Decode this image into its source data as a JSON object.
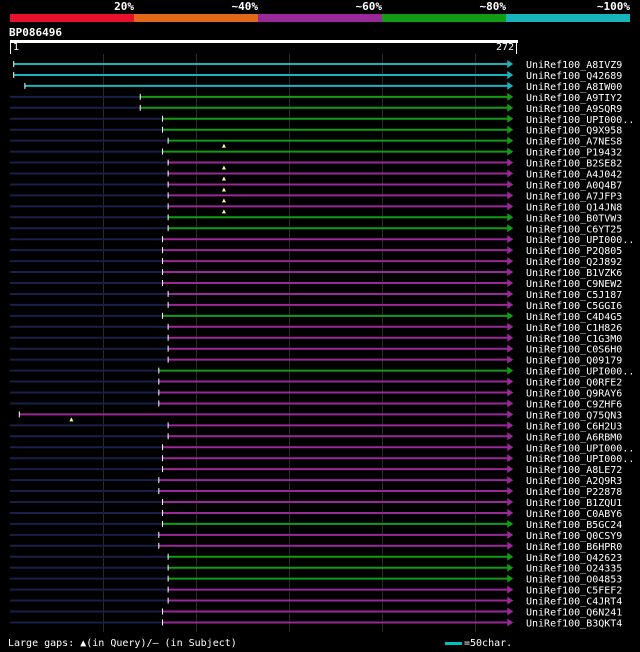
{
  "legend": {
    "labels": [
      "20%",
      "~40%",
      "~60%",
      "~80%",
      "~100%"
    ],
    "colors": [
      "#e8102c",
      "#e06818",
      "#9a2898",
      "#139c13",
      "#18b4bc"
    ]
  },
  "query": {
    "id": "BP086496",
    "start": "1",
    "end": "272"
  },
  "hits": [
    {
      "label": "UniRef100_A8IVZ9",
      "color": "#18b4bc",
      "segments": [
        [
          2,
          270
        ]
      ],
      "dark": [],
      "marks": []
    },
    {
      "label": "UniRef100_Q42689",
      "color": "#18b4bc",
      "segments": [
        [
          2,
          270
        ]
      ],
      "dark": [],
      "marks": []
    },
    {
      "label": "UniRef100_A8IW00",
      "color": "#18b4bc",
      "segments": [
        [
          8,
          270
        ]
      ],
      "dark": [],
      "marks": []
    },
    {
      "label": "UniRef100_A9TIY2",
      "color": "#139c13",
      "segments": [
        [
          70,
          270
        ]
      ],
      "dark": [
        [
          0,
          70
        ]
      ],
      "marks": []
    },
    {
      "label": "UniRef100_A9SQR9",
      "color": "#139c13",
      "segments": [
        [
          70,
          270
        ]
      ],
      "dark": [
        [
          0,
          70
        ]
      ],
      "marks": []
    },
    {
      "label": "UniRef100_UPI000..",
      "color": "#139c13",
      "segments": [
        [
          82,
          270
        ]
      ],
      "dark": [
        [
          0,
          82
        ]
      ],
      "marks": []
    },
    {
      "label": "UniRef100_Q9X958",
      "color": "#139c13",
      "segments": [
        [
          82,
          270
        ]
      ],
      "dark": [
        [
          0,
          82
        ]
      ],
      "marks": []
    },
    {
      "label": "UniRef100_A7NES8",
      "color": "#139c13",
      "segments": [
        [
          85,
          270
        ]
      ],
      "dark": [
        [
          0,
          85
        ]
      ],
      "marks": [
        115
      ]
    },
    {
      "label": "UniRef100_P19432",
      "color": "#139c13",
      "segments": [
        [
          82,
          270
        ]
      ],
      "dark": [
        [
          0,
          82
        ]
      ],
      "marks": []
    },
    {
      "label": "UniRef100_B2SE82",
      "color": "#9a2898",
      "segments": [
        [
          85,
          270
        ]
      ],
      "dark": [
        [
          0,
          85
        ]
      ],
      "marks": [
        115
      ]
    },
    {
      "label": "UniRef100_A4J042",
      "color": "#9a2898",
      "segments": [
        [
          85,
          270
        ]
      ],
      "dark": [
        [
          0,
          85
        ]
      ],
      "marks": [
        115
      ]
    },
    {
      "label": "UniRef100_A0Q4B7",
      "color": "#9a2898",
      "segments": [
        [
          85,
          270
        ]
      ],
      "dark": [
        [
          0,
          85
        ]
      ],
      "marks": [
        115
      ]
    },
    {
      "label": "UniRef100_A7JFP3",
      "color": "#9a2898",
      "segments": [
        [
          85,
          270
        ]
      ],
      "dark": [
        [
          0,
          85
        ]
      ],
      "marks": [
        115
      ]
    },
    {
      "label": "UniRef100_Q14JN8",
      "color": "#9a2898",
      "segments": [
        [
          85,
          270
        ]
      ],
      "dark": [
        [
          0,
          85
        ]
      ],
      "marks": [
        115
      ]
    },
    {
      "label": "UniRef100_B0TVW3",
      "color": "#139c13",
      "segments": [
        [
          85,
          270
        ]
      ],
      "dark": [
        [
          0,
          85
        ]
      ],
      "marks": []
    },
    {
      "label": "UniRef100_C6YT25",
      "color": "#139c13",
      "segments": [
        [
          85,
          270
        ]
      ],
      "dark": [
        [
          0,
          85
        ]
      ],
      "marks": []
    },
    {
      "label": "UniRef100_UPI000..",
      "color": "#9a2898",
      "segments": [
        [
          82,
          270
        ]
      ],
      "dark": [
        [
          0,
          82
        ]
      ],
      "marks": []
    },
    {
      "label": "UniRef100_P2Q805",
      "color": "#9a2898",
      "segments": [
        [
          82,
          270
        ]
      ],
      "dark": [
        [
          0,
          82
        ]
      ],
      "marks": []
    },
    {
      "label": "UniRef100_Q2J892",
      "color": "#9a2898",
      "segments": [
        [
          82,
          270
        ]
      ],
      "dark": [
        [
          0,
          82
        ]
      ],
      "marks": []
    },
    {
      "label": "UniRef100_B1VZK6",
      "color": "#9a2898",
      "segments": [
        [
          82,
          270
        ]
      ],
      "dark": [
        [
          0,
          82
        ]
      ],
      "marks": []
    },
    {
      "label": "UniRef100_C9NEW2",
      "color": "#9a2898",
      "segments": [
        [
          82,
          270
        ]
      ],
      "dark": [
        [
          0,
          82
        ]
      ],
      "marks": []
    },
    {
      "label": "UniRef100_C5J187",
      "color": "#9a2898",
      "segments": [
        [
          85,
          270
        ]
      ],
      "dark": [
        [
          0,
          85
        ]
      ],
      "marks": []
    },
    {
      "label": "UniRef100_C5GGI6",
      "color": "#9a2898",
      "segments": [
        [
          85,
          270
        ]
      ],
      "dark": [
        [
          0,
          85
        ]
      ],
      "marks": []
    },
    {
      "label": "UniRef100_C4D4G5",
      "color": "#139c13",
      "segments": [
        [
          82,
          270
        ]
      ],
      "dark": [
        [
          0,
          82
        ]
      ],
      "marks": []
    },
    {
      "label": "UniRef100_C1H826",
      "color": "#9a2898",
      "segments": [
        [
          85,
          270
        ]
      ],
      "dark": [
        [
          0,
          85
        ]
      ],
      "marks": []
    },
    {
      "label": "UniRef100_C1G3M0",
      "color": "#9a2898",
      "segments": [
        [
          85,
          270
        ]
      ],
      "dark": [
        [
          0,
          85
        ]
      ],
      "marks": []
    },
    {
      "label": "UniRef100_C0S6H0",
      "color": "#9a2898",
      "segments": [
        [
          85,
          270
        ]
      ],
      "dark": [
        [
          0,
          85
        ]
      ],
      "marks": []
    },
    {
      "label": "UniRef100_Q09179",
      "color": "#9a2898",
      "segments": [
        [
          85,
          270
        ]
      ],
      "dark": [
        [
          0,
          85
        ]
      ],
      "marks": []
    },
    {
      "label": "UniRef100_UPI000..",
      "color": "#139c13",
      "segments": [
        [
          80,
          270
        ]
      ],
      "dark": [
        [
          0,
          80
        ]
      ],
      "marks": []
    },
    {
      "label": "UniRef100_Q0RFE2",
      "color": "#9a2898",
      "segments": [
        [
          80,
          270
        ]
      ],
      "dark": [
        [
          0,
          80
        ]
      ],
      "marks": []
    },
    {
      "label": "UniRef100_Q9RAY6",
      "color": "#9a2898",
      "segments": [
        [
          80,
          270
        ]
      ],
      "dark": [
        [
          0,
          80
        ]
      ],
      "marks": []
    },
    {
      "label": "UniRef100_C9ZHF6",
      "color": "#9a2898",
      "segments": [
        [
          80,
          270
        ]
      ],
      "dark": [
        [
          0,
          80
        ]
      ],
      "marks": []
    },
    {
      "label": "UniRef100_Q75QN3",
      "color": "#9a2898",
      "segments": [
        [
          5,
          270
        ]
      ],
      "dark": [],
      "marks": [
        33
      ]
    },
    {
      "label": "UniRef100_C6H2U3",
      "color": "#9a2898",
      "segments": [
        [
          85,
          270
        ]
      ],
      "dark": [
        [
          0,
          85
        ]
      ],
      "marks": []
    },
    {
      "label": "UniRef100_A6RBM0",
      "color": "#9a2898",
      "segments": [
        [
          85,
          270
        ]
      ],
      "dark": [
        [
          0,
          85
        ]
      ],
      "marks": []
    },
    {
      "label": "UniRef100_UPI000..",
      "color": "#9a2898",
      "segments": [
        [
          82,
          270
        ]
      ],
      "dark": [
        [
          0,
          82
        ]
      ],
      "marks": []
    },
    {
      "label": "UniRef100_UPI000..",
      "color": "#9a2898",
      "segments": [
        [
          82,
          270
        ]
      ],
      "dark": [
        [
          0,
          82
        ]
      ],
      "marks": []
    },
    {
      "label": "UniRef100_A8LE72",
      "color": "#9a2898",
      "segments": [
        [
          82,
          270
        ]
      ],
      "dark": [
        [
          0,
          82
        ]
      ],
      "marks": []
    },
    {
      "label": "UniRef100_A2Q9R3",
      "color": "#9a2898",
      "segments": [
        [
          80,
          270
        ]
      ],
      "dark": [
        [
          0,
          80
        ]
      ],
      "marks": []
    },
    {
      "label": "UniRef100_P22878",
      "color": "#9a2898",
      "segments": [
        [
          80,
          270
        ]
      ],
      "dark": [
        [
          0,
          80
        ]
      ],
      "marks": []
    },
    {
      "label": "UniRef100_B1ZQU1",
      "color": "#9a2898",
      "segments": [
        [
          82,
          270
        ]
      ],
      "dark": [
        [
          0,
          82
        ]
      ],
      "marks": []
    },
    {
      "label": "UniRef100_C0ABY6",
      "color": "#9a2898",
      "segments": [
        [
          82,
          270
        ]
      ],
      "dark": [
        [
          0,
          82
        ]
      ],
      "marks": []
    },
    {
      "label": "UniRef100_B5GC24",
      "color": "#139c13",
      "segments": [
        [
          82,
          270
        ]
      ],
      "dark": [
        [
          0,
          82
        ]
      ],
      "marks": []
    },
    {
      "label": "UniRef100_Q0CSY9",
      "color": "#9a2898",
      "segments": [
        [
          80,
          270
        ]
      ],
      "dark": [
        [
          0,
          80
        ]
      ],
      "marks": []
    },
    {
      "label": "UniRef100_B6HPR0",
      "color": "#9a2898",
      "segments": [
        [
          80,
          270
        ]
      ],
      "dark": [
        [
          0,
          80
        ]
      ],
      "marks": []
    },
    {
      "label": "UniRef100_Q42623",
      "color": "#139c13",
      "segments": [
        [
          85,
          270
        ]
      ],
      "dark": [
        [
          0,
          85
        ]
      ],
      "marks": []
    },
    {
      "label": "UniRef100_O24335",
      "color": "#139c13",
      "segments": [
        [
          85,
          270
        ]
      ],
      "dark": [
        [
          0,
          85
        ]
      ],
      "marks": []
    },
    {
      "label": "UniRef100_O04853",
      "color": "#139c13",
      "segments": [
        [
          85,
          270
        ]
      ],
      "dark": [
        [
          0,
          85
        ]
      ],
      "marks": []
    },
    {
      "label": "UniRef100_C5FEF2",
      "color": "#9a2898",
      "segments": [
        [
          85,
          270
        ]
      ],
      "dark": [
        [
          0,
          85
        ]
      ],
      "marks": []
    },
    {
      "label": "UniRef100_C4JRT4",
      "color": "#9a2898",
      "segments": [
        [
          85,
          270
        ]
      ],
      "dark": [
        [
          0,
          85
        ]
      ],
      "marks": []
    },
    {
      "label": "UniRef100_Q6N241",
      "color": "#9a2898",
      "segments": [
        [
          82,
          270
        ]
      ],
      "dark": [
        [
          0,
          82
        ]
      ],
      "marks": []
    },
    {
      "label": "UniRef100_B3QKT4",
      "color": "#9a2898",
      "segments": [
        [
          82,
          270
        ]
      ],
      "dark": [
        [
          0,
          82
        ]
      ],
      "marks": []
    }
  ],
  "footer": {
    "gaps_text": "Large gaps: ▲(in Query)/— (in Subject)",
    "scale_text": "=50char.",
    "scale_color": "#00c0c0"
  }
}
